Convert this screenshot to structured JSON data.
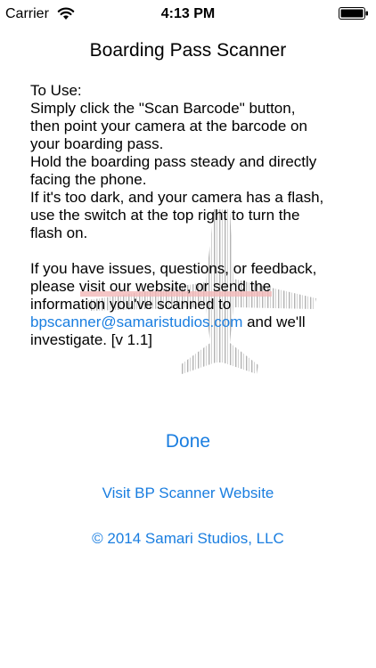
{
  "status_bar": {
    "carrier": "Carrier",
    "time": "4:13 PM",
    "wifi_icon": "wifi-icon",
    "battery_icon": "battery-icon"
  },
  "title": "Boarding Pass Scanner",
  "instructions": {
    "lines": [
      "To Use:",
      "Simply click the \"Scan Barcode\" button,",
      "then point your camera at the barcode on",
      "your boarding pass.",
      "Hold the boarding pass steady and directly",
      "facing the phone.",
      "If it's too dark, and your camera has a flash,",
      "use the switch at the top right to turn the",
      "flash on."
    ],
    "feedback_lines": [
      "If you have issues, questions, or feedback,",
      "please visit our website, or send the",
      "information you've scanned to"
    ],
    "email": "bpscanner@samaristudios.com",
    "email_suffix": " and we'll",
    "last_line": "investigate. [v 1.1]"
  },
  "watermark_icon": "barcode-airplane-icon",
  "colors": {
    "link": "#1a7ee0",
    "text": "#000000",
    "background": "#ffffff"
  },
  "actions": {
    "done_label": "Done",
    "website_label": "Visit BP Scanner Website",
    "copyright_label": "© 2014 Samari Studios, LLC"
  }
}
